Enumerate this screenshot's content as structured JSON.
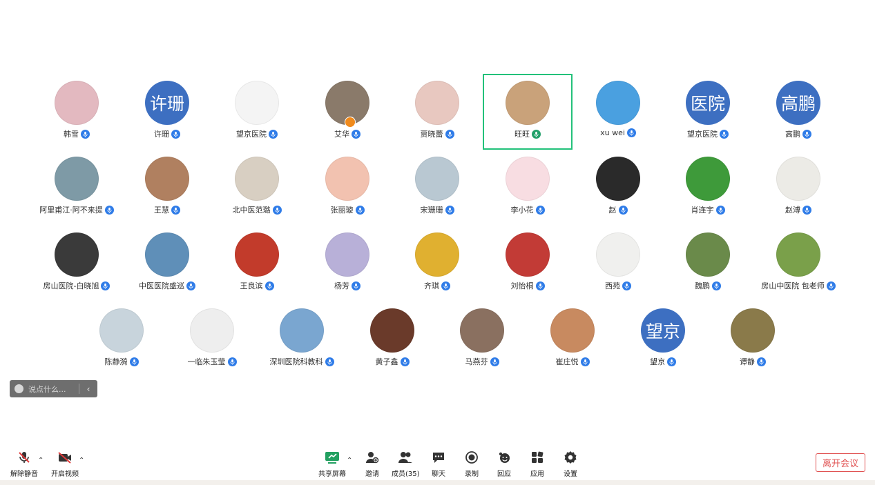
{
  "participants": [
    {
      "name": "韩雪",
      "avatar": "photo",
      "bg": "#e3b9c0"
    },
    {
      "name": "许珊",
      "avatar": "text",
      "text": "许珊"
    },
    {
      "name": "望京医院",
      "avatar": "photo",
      "bg": "#f4f4f4"
    },
    {
      "name": "艾华",
      "avatar": "photo",
      "bg": "#8a7a6a",
      "host": true
    },
    {
      "name": "贾晓蕾",
      "avatar": "photo",
      "bg": "#e8c8c0"
    },
    {
      "name": "旺旺",
      "avatar": "photo",
      "bg": "#c9a27a",
      "active": true,
      "speaking": true
    },
    {
      "name": "xu wei",
      "avatar": "photo",
      "bg": "#4aa0e0"
    },
    {
      "name": "望京医院",
      "avatar": "text",
      "text": "医院"
    },
    {
      "name": "高鹏",
      "avatar": "text",
      "text": "高鹏"
    },
    {
      "name": "阿里甫江·阿不来提",
      "avatar": "photo",
      "bg": "#7e9aa6"
    },
    {
      "name": "王慧",
      "avatar": "photo",
      "bg": "#b08060"
    },
    {
      "name": "北中医范璐",
      "avatar": "photo",
      "bg": "#d8cfc2"
    },
    {
      "name": "张丽璇",
      "avatar": "photo",
      "bg": "#f2c2b0"
    },
    {
      "name": "宋珊珊",
      "avatar": "photo",
      "bg": "#b9c8d2"
    },
    {
      "name": "李小花",
      "avatar": "photo",
      "bg": "#f8dde2"
    },
    {
      "name": "赵",
      "avatar": "photo",
      "bg": "#2a2a2a"
    },
    {
      "name": "肖连宇",
      "avatar": "photo",
      "bg": "#3e9a3a"
    },
    {
      "name": "赵溥",
      "avatar": "photo",
      "bg": "#ecebe6"
    },
    {
      "name": "房山医院-白晓旭",
      "avatar": "photo",
      "bg": "#3a3a3a"
    },
    {
      "name": "中医医院盛巡",
      "avatar": "photo",
      "bg": "#5f8fb8"
    },
    {
      "name": "王良滨",
      "avatar": "photo",
      "bg": "#c23b2b"
    },
    {
      "name": "杨芳",
      "avatar": "photo",
      "bg": "#b8b0d8"
    },
    {
      "name": "齐琪",
      "avatar": "photo",
      "bg": "#e0b030"
    },
    {
      "name": "刘怡桐",
      "avatar": "photo",
      "bg": "#c23b36"
    },
    {
      "name": "西苑",
      "avatar": "photo",
      "bg": "#f0f0ee"
    },
    {
      "name": "魏鹏",
      "avatar": "photo",
      "bg": "#6a8a4a"
    },
    {
      "name": "房山中医院 包老师",
      "avatar": "photo",
      "bg": "#7aa04a"
    },
    {
      "name": "陈静漪",
      "avatar": "photo",
      "bg": "#c8d4dc"
    },
    {
      "name": "一临朱玉莹",
      "avatar": "photo",
      "bg": "#eeeeee"
    },
    {
      "name": "深圳医院科教科",
      "avatar": "photo",
      "bg": "#7aa6d0"
    },
    {
      "name": "黄子鑫",
      "avatar": "photo",
      "bg": "#6a3a2a"
    },
    {
      "name": "马燕芬",
      "avatar": "photo",
      "bg": "#8a7060"
    },
    {
      "name": "崔庄悦",
      "avatar": "photo",
      "bg": "#c88a60"
    },
    {
      "name": "望京",
      "avatar": "text",
      "text": "望京"
    },
    {
      "name": "谭静",
      "avatar": "photo",
      "bg": "#8a7a4a"
    }
  ],
  "chat": {
    "placeholder": "说点什么..."
  },
  "toolbar": {
    "unmute": "解除静音",
    "start_video": "开启视频",
    "share": "共享屏幕",
    "invite": "邀请",
    "members": "成员(35)",
    "chat": "聊天",
    "record": "录制",
    "reaction": "回应",
    "apps": "应用",
    "settings": "设置",
    "leave": "离开会议"
  },
  "colors": {
    "accent": "#2f7ce8",
    "active_border": "#22c17a",
    "leave": "#e05050",
    "text_avatar": "#3d6fc1"
  }
}
